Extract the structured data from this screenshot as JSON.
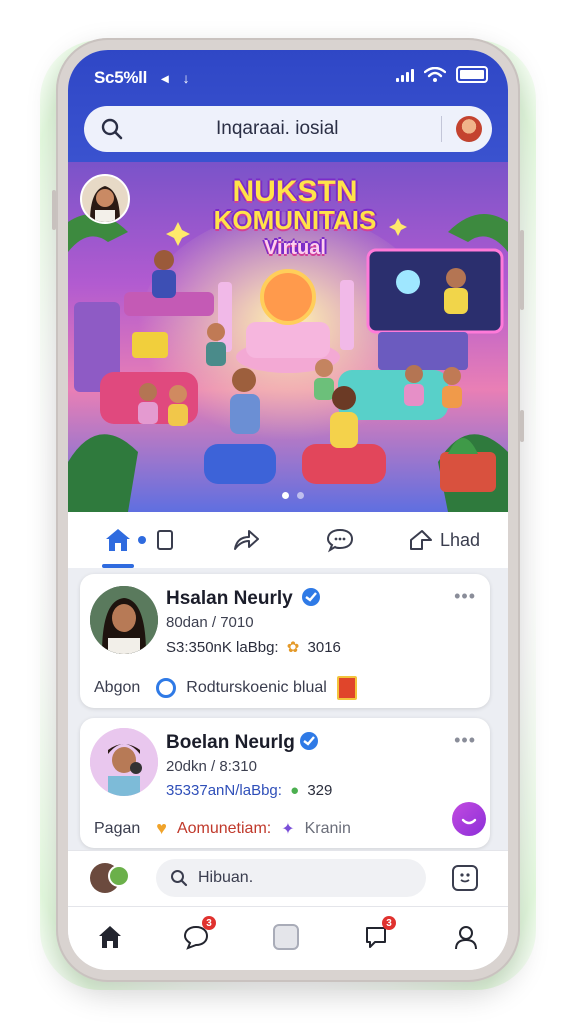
{
  "status_bar": {
    "carrier": "Sc5%ll",
    "arrow": "↓"
  },
  "search": {
    "text": "Inqaraai. iosial"
  },
  "banner": {
    "title_line1": "NUKSTN",
    "title_line2": "KOMUNITAIS",
    "title_line3": "Virtual"
  },
  "tabs": [
    {
      "icon": "home-icon"
    },
    {
      "icon": "square-icon"
    },
    {
      "icon": "share-icon"
    },
    {
      "icon": "chat-bubble-icon"
    },
    {
      "icon": "send-icon",
      "label": "Lhad"
    }
  ],
  "posts": [
    {
      "name": "Hsalan Neurly",
      "meta": "80dan / 7010",
      "meta2_text": "S3:350nK laBbg:",
      "meta2_count": "3016",
      "action1": "Abgon",
      "action2": "Rodturskoenic blual"
    },
    {
      "name": "Boelan Neurlg",
      "meta": "20dkn / 8:310",
      "meta2_text": "35337anN/laBbg:",
      "meta2_count": "329",
      "action1": "Pagan",
      "action2": "Aomunetiam:",
      "action3": "Kranin"
    }
  ],
  "composer": {
    "placeholder": "Hibuan."
  },
  "bottom_nav": {
    "badge_messages": "3",
    "badge_notifications": "3"
  },
  "colors": {
    "header": "#2f47c6",
    "accent": "#2f6bdf",
    "verified": "#2f7ae6",
    "fab": "#a23ce0"
  }
}
